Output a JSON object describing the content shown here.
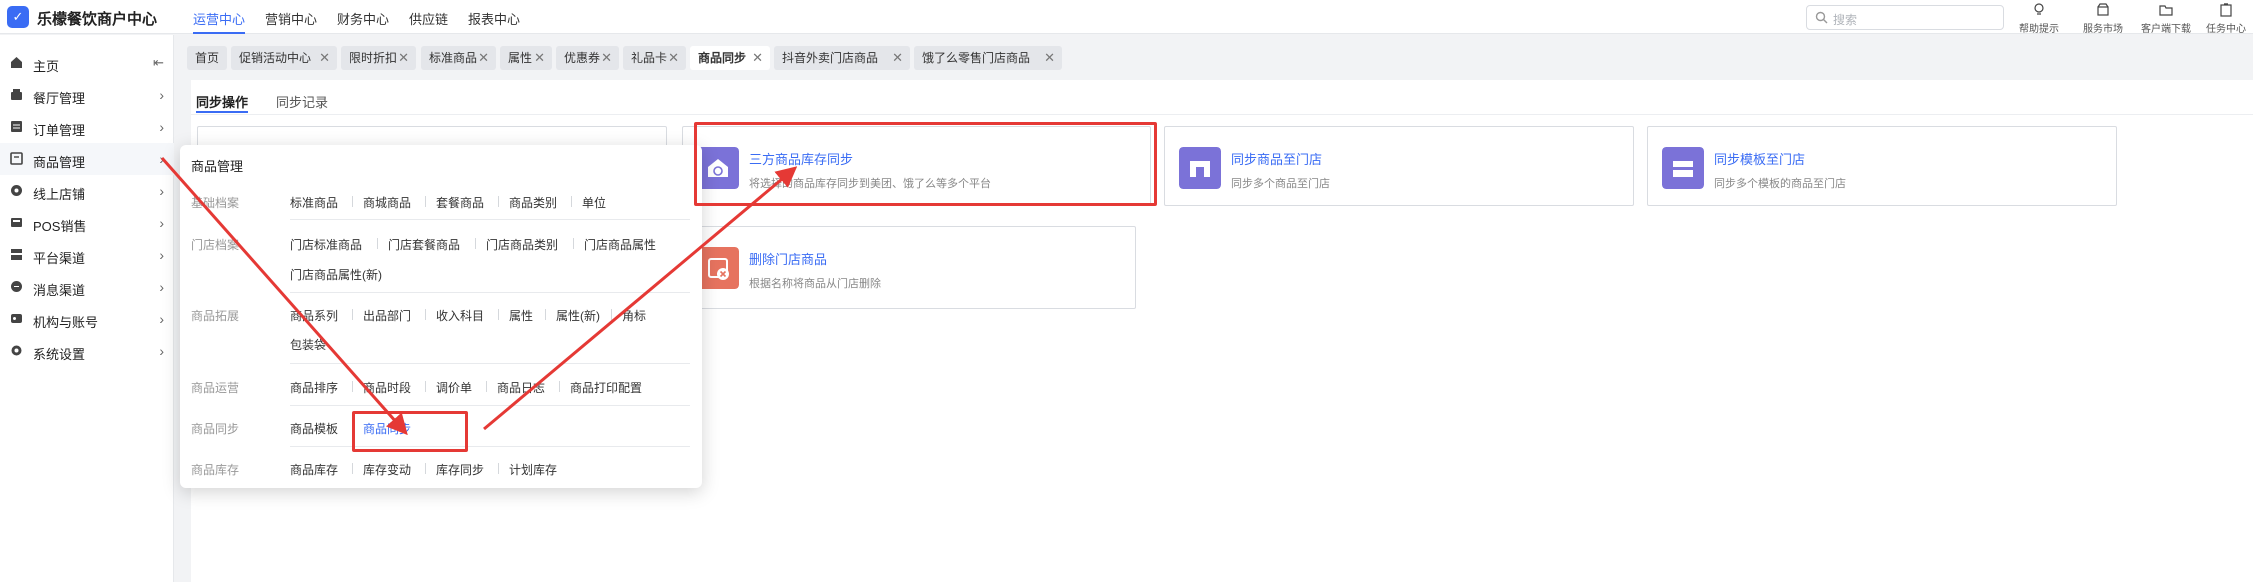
{
  "app": {
    "title": "乐檬餐饮商户中心",
    "logo_icon": "app-logo-icon",
    "brand_color": "#3a6cf4"
  },
  "topnav": [
    {
      "label": "运营中心",
      "active": true
    },
    {
      "label": "营销中心"
    },
    {
      "label": "财务中心"
    },
    {
      "label": "供应链"
    },
    {
      "label": "报表中心"
    }
  ],
  "search": {
    "placeholder": "搜索",
    "icon": "search-icon"
  },
  "toolbar": [
    {
      "label": "帮助提示",
      "icon": "lightbulb-icon"
    },
    {
      "label": "服务市场",
      "icon": "store-icon"
    },
    {
      "label": "客户端下载",
      "icon": "download-icon"
    },
    {
      "label": "任务中心",
      "icon": "clipboard-icon"
    }
  ],
  "sidebar": {
    "items": [
      {
        "label": "主页",
        "icon": "home-icon",
        "trailing": "collapse-icon"
      },
      {
        "label": "餐厅管理",
        "icon": "restaurant-icon"
      },
      {
        "label": "订单管理",
        "icon": "order-icon"
      },
      {
        "label": "商品管理",
        "icon": "product-icon",
        "active": true
      },
      {
        "label": "线上店铺",
        "icon": "shop-icon"
      },
      {
        "label": "POS销售",
        "icon": "pos-icon"
      },
      {
        "label": "平台渠道",
        "icon": "platform-icon"
      },
      {
        "label": "消息渠道",
        "icon": "message-icon"
      },
      {
        "label": "机构与账号",
        "icon": "org-icon"
      },
      {
        "label": "系统设置",
        "icon": "gear-icon"
      }
    ]
  },
  "tabs": [
    {
      "label": "首页",
      "closable": false
    },
    {
      "label": "促销活动中心",
      "closable": true
    },
    {
      "label": "限时折扣",
      "closable": true
    },
    {
      "label": "标准商品",
      "closable": true
    },
    {
      "label": "属性",
      "closable": true
    },
    {
      "label": "优惠券",
      "closable": true
    },
    {
      "label": "礼品卡",
      "closable": true
    },
    {
      "label": "商品同步",
      "closable": true,
      "active": true
    },
    {
      "label": "抖音外卖门店商品",
      "closable": true
    },
    {
      "label": "饿了么零售门店商品",
      "closable": true
    }
  ],
  "subtabs": [
    {
      "label": "同步操作",
      "active": true
    },
    {
      "label": "同步记录"
    }
  ],
  "cards": [
    {
      "title": "三方商品库存同步",
      "desc": "将选择的商品库存同步到美团、饿了么等多个平台",
      "icon": "sync-store-icon",
      "color": "#7b72d8"
    },
    {
      "title": "同步商品至门店",
      "desc": "同步多个商品至门店",
      "icon": "store-front-icon",
      "color": "#7b72d8"
    },
    {
      "title": "同步模板至门店",
      "desc": "同步多个模板的商品至门店",
      "icon": "template-store-icon",
      "color": "#7b72d8"
    },
    {
      "title": "删除门店商品",
      "desc": "根据名称将商品从门店删除",
      "icon": "delete-product-icon",
      "color": "#e6735f"
    }
  ],
  "dropdown": {
    "title": "商品管理",
    "sections": [
      {
        "category": "基础档案",
        "links": [
          "标准商品",
          "商城商品",
          "套餐商品",
          "商品类别",
          "单位"
        ]
      },
      {
        "category": "门店档案",
        "links": [
          "门店标准商品",
          "门店套餐商品",
          "门店商品类别",
          "门店商品属性",
          "门店商品属性(新)"
        ]
      },
      {
        "category": "商品拓展",
        "links": [
          "商品系列",
          "出品部门",
          "收入科目",
          "属性",
          "属性(新)",
          "角标",
          "包装袋"
        ]
      },
      {
        "category": "商品运营",
        "links": [
          "商品排序",
          "商品时段",
          "调价单",
          "商品日志",
          "商品打印配置"
        ]
      },
      {
        "category": "商品同步",
        "links": [
          "商品模板",
          "商品同步"
        ],
        "active_link": "商品同步"
      },
      {
        "category": "商品库存",
        "links": [
          "商品库存",
          "库存变动",
          "库存同步",
          "计划库存"
        ]
      }
    ]
  },
  "annotation_color": "#e53935"
}
